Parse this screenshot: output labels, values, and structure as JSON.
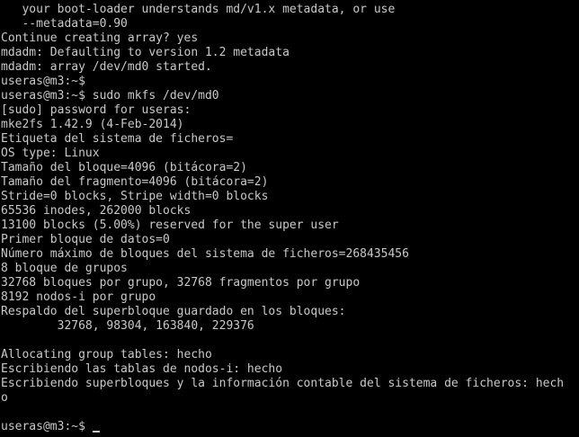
{
  "terminal": {
    "lines": [
      "   your boot-loader understands md/v1.x metadata, or use",
      "   --metadata=0.90",
      "Continue creating array? yes",
      "mdadm: Defaulting to version 1.2 metadata",
      "mdadm: array /dev/md0 started.",
      "useras@m3:~$",
      "useras@m3:~$ sudo mkfs /dev/md0",
      "[sudo] password for useras:",
      "mke2fs 1.42.9 (4-Feb-2014)",
      "Etiqueta del sistema de ficheros=",
      "OS type: Linux",
      "Tamaño del bloque=4096 (bitácora=2)",
      "Tamaño del fragmento=4096 (bitácora=2)",
      "Stride=0 blocks, Stripe width=0 blocks",
      "65536 inodes, 262000 blocks",
      "13100 blocks (5.00%) reserved for the super user",
      "Primer bloque de datos=0",
      "Número máximo de bloques del sistema de ficheros=268435456",
      "8 bloque de grupos",
      "32768 bloques por grupo, 32768 fragmentos por grupo",
      "8192 nodos-i por grupo",
      "Respaldo del superbloque guardado en los bloques:",
      "        32768, 98304, 163840, 229376",
      "",
      "Allocating group tables: hecho",
      "Escribiendo las tablas de nodos-i: hecho",
      "Escribiendo superbloques y la información contable del sistema de ficheros: hech",
      "o",
      "",
      ""
    ],
    "prompt": "useras@m3:~$"
  }
}
